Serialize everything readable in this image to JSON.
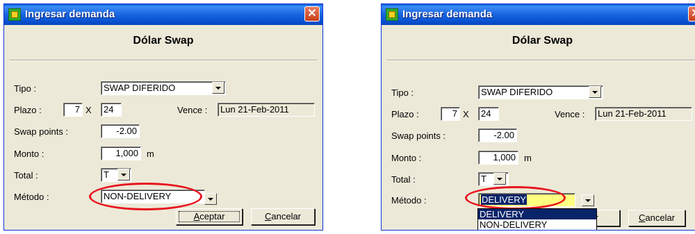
{
  "dialogs": [
    {
      "title": "Ingresar demanda",
      "heading": "Dólar Swap",
      "close_glyph": "✕",
      "tipo_label": "Tipo :",
      "tipo_value": "SWAP DIFERIDO",
      "plazo_label": "Plazo :",
      "plazo_count": "7",
      "plazo_times": "X",
      "plazo_days": "24",
      "vence_label": "Vence :",
      "vence_value": "Lun  21-Feb-2011",
      "swap_points_label": "Swap points :",
      "swap_points_value": "-2.00",
      "monto_label": "Monto :",
      "monto_value": "1,000",
      "monto_unit": "m",
      "total_label": "Total :",
      "total_value": "T",
      "metodo_label": "Método :",
      "metodo_value": "NON-DELIVERY",
      "accept_pre": "",
      "accept_ul": "A",
      "accept_post": "ceptar",
      "cancel_pre": "",
      "cancel_ul": "C",
      "cancel_post": "ancelar"
    },
    {
      "title": "Ingresar demanda",
      "heading": "Dólar Swap",
      "close_glyph": "✕",
      "tipo_label": "Tipo :",
      "tipo_value": "SWAP DIFERIDO",
      "plazo_label": "Plazo :",
      "plazo_count": "7",
      "plazo_times": "X",
      "plazo_days": "24",
      "vence_label": "Vence :",
      "vence_value": "Lun  21-Feb-2011",
      "swap_points_label": "Swap points :",
      "swap_points_value": "-2.00",
      "monto_label": "Monto :",
      "monto_value": "1,000",
      "monto_unit": "m",
      "total_label": "Total :",
      "total_value": "T",
      "metodo_label": "Método :",
      "metodo_value": "DELIVERY",
      "accept_visible": "ar",
      "cancel_pre": "",
      "cancel_ul": "C",
      "cancel_post": "ancelar",
      "metodo_options": [
        "DELIVERY",
        "NON-DELIVERY"
      ]
    }
  ],
  "colors": {
    "titlebar": "#0a5fd8",
    "dialog_bg": "#ece9d8",
    "highlight_circle": "#e8141e",
    "selection": "#0a246a",
    "input_highlight": "#ffff80"
  },
  "icons": [
    "app-icon",
    "close-icon",
    "chevron-down-icon"
  ]
}
